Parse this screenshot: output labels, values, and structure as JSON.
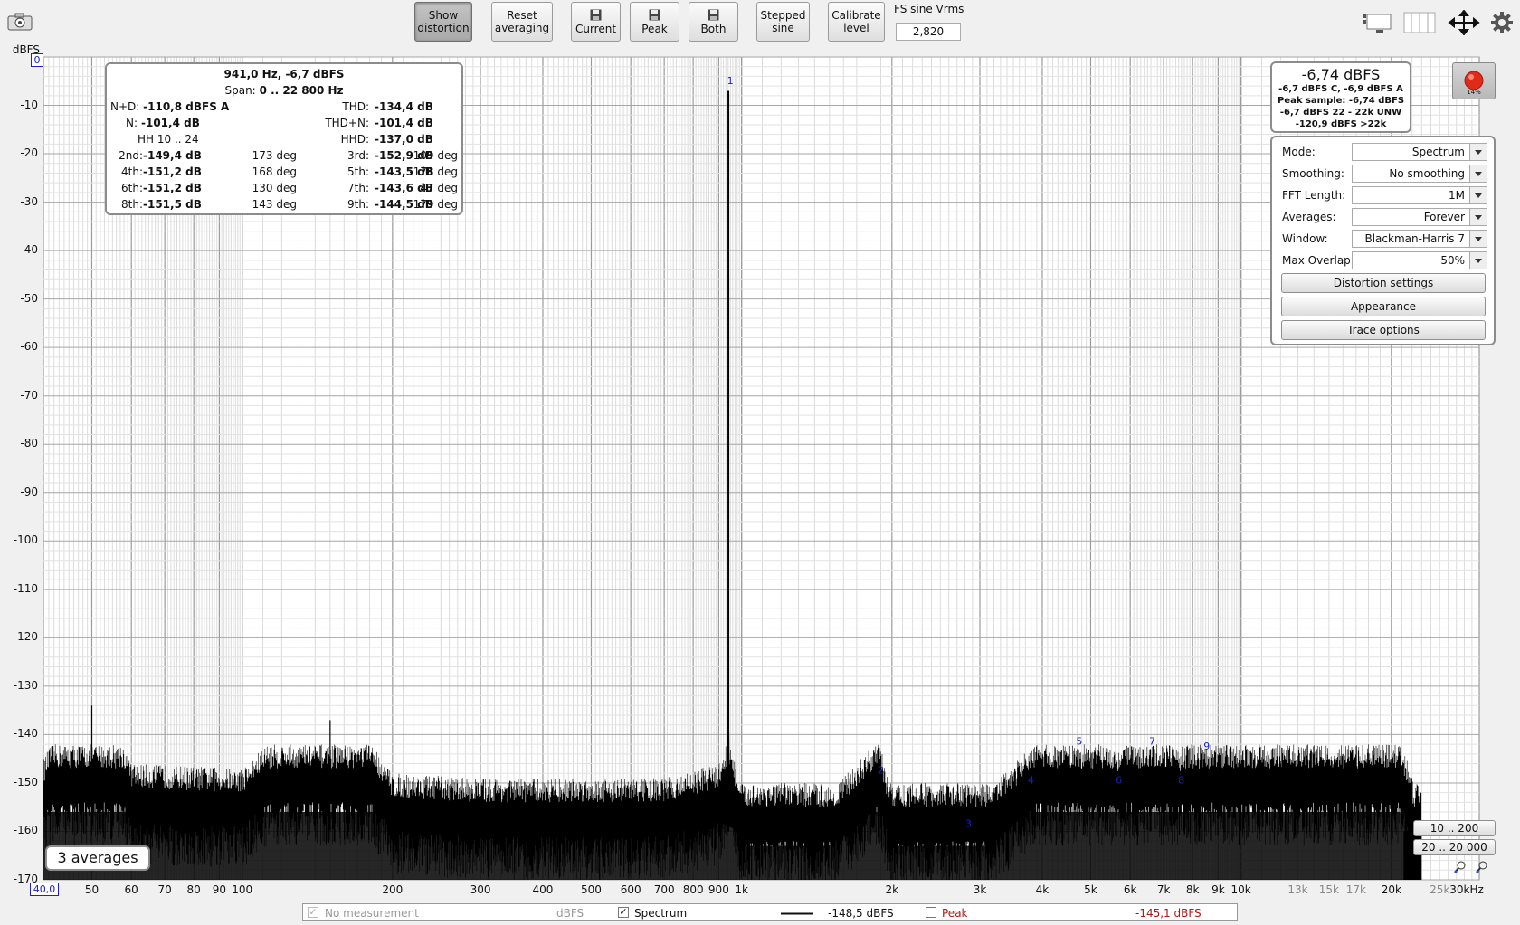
{
  "toolbar": {
    "show_distortion": [
      "Show",
      "distortion"
    ],
    "reset_averaging": [
      "Reset",
      "averaging"
    ],
    "current": "Current",
    "peak": "Peak",
    "both": "Both",
    "stepped_sine": [
      "Stepped",
      "sine"
    ],
    "calibrate_level": [
      "Calibrate",
      "level"
    ],
    "fs_label": "FS sine Vrms",
    "fs_value": "2,820"
  },
  "yaxis": {
    "unit": "dBFS",
    "top_value": "0",
    "unit_select": "dBFS",
    "ticks": [
      "-10",
      "-20",
      "-30",
      "-40",
      "-50",
      "-60",
      "-70",
      "-80",
      "-90",
      "-100",
      "-110",
      "-120",
      "-130",
      "-140",
      "-150",
      "-160",
      "-170"
    ],
    "range": [
      -170,
      0
    ]
  },
  "xaxis": {
    "start": "40,0",
    "ticks": [
      {
        "v": 50,
        "t": "50"
      },
      {
        "v": 60,
        "t": "60"
      },
      {
        "v": 70,
        "t": "70"
      },
      {
        "v": 80,
        "t": "80"
      },
      {
        "v": 90,
        "t": "90"
      },
      {
        "v": 100,
        "t": "100"
      },
      {
        "v": 200,
        "t": "200"
      },
      {
        "v": 300,
        "t": "300"
      },
      {
        "v": 400,
        "t": "400"
      },
      {
        "v": 500,
        "t": "500"
      },
      {
        "v": 600,
        "t": "600"
      },
      {
        "v": 700,
        "t": "700"
      },
      {
        "v": 800,
        "t": "800"
      },
      {
        "v": 900,
        "t": "900"
      },
      {
        "v": 1000,
        "t": "1k"
      },
      {
        "v": 2000,
        "t": "2k"
      },
      {
        "v": 3000,
        "t": "3k"
      },
      {
        "v": 4000,
        "t": "4k"
      },
      {
        "v": 5000,
        "t": "5k"
      },
      {
        "v": 6000,
        "t": "6k"
      },
      {
        "v": 7000,
        "t": "7k"
      },
      {
        "v": 8000,
        "t": "8k"
      },
      {
        "v": 9000,
        "t": "9k"
      },
      {
        "v": 10000,
        "t": "10k"
      },
      {
        "v": 13000,
        "t": "13k",
        "minor": true
      },
      {
        "v": 15000,
        "t": "15k",
        "minor": true
      },
      {
        "v": 17000,
        "t": "17k",
        "minor": true
      },
      {
        "v": 20000,
        "t": "20k"
      },
      {
        "v": 25000,
        "t": "25k",
        "minor": true
      },
      {
        "v": 30000,
        "t": "30kHz"
      }
    ],
    "range": [
      40,
      30000
    ]
  },
  "distortion": {
    "title": "941,0 Hz, -6,7 dBFS",
    "span_label": "Span:",
    "span_value": "0 .. 22 800 Hz",
    "nd_label": "N+D:",
    "nd_value": "-110,8 dBFS A",
    "thd_label": "THD:",
    "thd_value": "-134,4 dB",
    "n_label": "N:",
    "n_value": "-101,4 dB",
    "thdn_label": "THD+N:",
    "thdn_value": "-101,4 dB",
    "hh_label": "HH 10 .. 24",
    "hhd_label": "HHD:",
    "hhd_value": "-137,0 dB",
    "harmonics": [
      {
        "l1": "2nd:",
        "v1": "-149,4 dB",
        "d1": "173 deg",
        "l2": "3rd:",
        "v2": "-152,9 dB",
        "d2": "-109 deg"
      },
      {
        "l1": "4th:",
        "v1": "-151,2 dB",
        "d1": "168 deg",
        "l2": "5th:",
        "v2": "-143,5 dB",
        "d2": "-178 deg"
      },
      {
        "l1": "6th:",
        "v1": "-151,2 dB",
        "d1": "130 deg",
        "l2": "7th:",
        "v2": "-143,6 dB",
        "d2": "47 deg"
      },
      {
        "l1": "8th:",
        "v1": "-151,5 dB",
        "d1": "143 deg",
        "l2": "9th:",
        "v2": "-144,5 dB",
        "d2": "179 deg"
      }
    ]
  },
  "level_panel": {
    "main": "-6,74 dBFS",
    "line1": "-6,7 dBFS C, -6,9 dBFS A",
    "line2": "Peak sample: -6,74 dBFS",
    "line3": "-6,7 dBFS 22 - 22k UNW",
    "line4": "-120,9 dBFS >22k",
    "record_pct": "14%"
  },
  "settings": {
    "mode_label": "Mode:",
    "mode_value": "Spectrum",
    "smoothing_label": "Smoothing:",
    "smoothing_value": "No  smoothing",
    "fft_label": "FFT Length:",
    "fft_value": "1M",
    "averages_label": "Averages:",
    "averages_value": "Forever",
    "window_label": "Window:",
    "window_value": "Blackman-Harris 7",
    "overlap_label": "Max Overlap:",
    "overlap_value": "50%",
    "distortion_settings": "Distortion settings",
    "appearance": "Appearance",
    "trace_options": "Trace options"
  },
  "averages_badge": "3 averages",
  "range_buttons": {
    "r1": "10 .. 200",
    "r2": "20 .. 20 000"
  },
  "harmonic_markers": [
    {
      "n": "1",
      "f": 941
    },
    {
      "n": "2",
      "f": 1882
    },
    {
      "n": "3",
      "f": 2823
    },
    {
      "n": "4",
      "f": 3764
    },
    {
      "n": "5",
      "f": 4705
    },
    {
      "n": "6",
      "f": 5646
    },
    {
      "n": "7",
      "f": 6587
    },
    {
      "n": "8",
      "f": 7528
    },
    {
      "n": "9",
      "f": 8469
    }
  ],
  "legend": {
    "no_measurement": "No measurement",
    "no_measurement_unit": "dBFS",
    "spectrum": "Spectrum",
    "spectrum_value": "-148,5 dBFS",
    "peak": "Peak",
    "peak_value": "-145,1 dBFS",
    "peak_color": "#b01818"
  },
  "chart_data": {
    "type": "line",
    "xscale": "log",
    "xlim": [
      40,
      30000
    ],
    "ylim": [
      -170,
      0
    ],
    "ylabel": "dBFS",
    "series": [
      {
        "name": "Spectrum",
        "x": [
          40,
          50,
          60,
          100,
          150,
          200,
          300,
          500,
          700,
          900,
          930,
          941,
          952,
          1000,
          1500,
          1882,
          2000,
          2823,
          3000,
          3764,
          4705,
          5646,
          6587,
          7528,
          8469,
          10000,
          12000,
          15000,
          18000,
          20000,
          22000,
          23000,
          25000
        ],
        "y": [
          -153,
          -134,
          -154,
          -155,
          -137,
          -156,
          -157,
          -157,
          -157,
          -154,
          -150,
          -7,
          -150,
          -160,
          -160,
          -149,
          -160,
          -160,
          -161,
          -151,
          -143,
          -151,
          -143,
          -151,
          -144,
          -146,
          -146,
          -145,
          -147,
          -145,
          -156,
          -170,
          -170
        ]
      }
    ]
  }
}
